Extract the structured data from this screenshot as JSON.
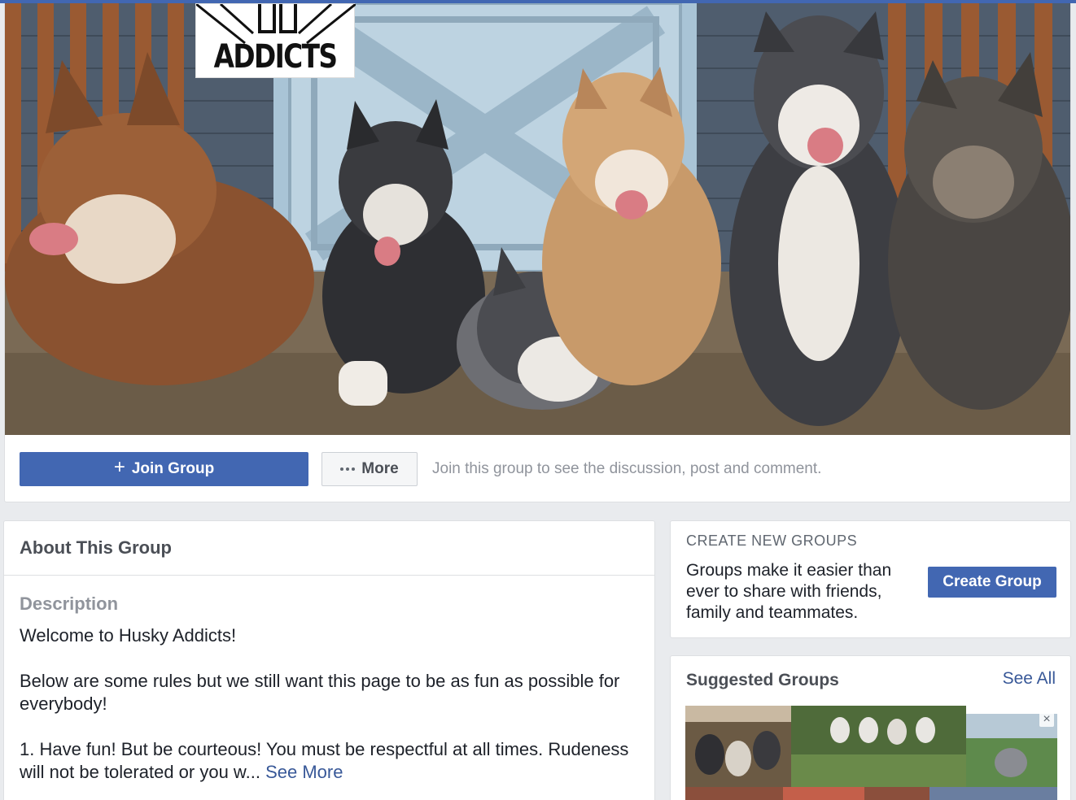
{
  "group": {
    "logo_text": "ADDICTS",
    "join_button": "Join Group",
    "more_button": "More",
    "join_hint": "Join this group to see the discussion, post and comment."
  },
  "about": {
    "title": "About This Group",
    "description_label": "Description",
    "paragraphs": [
      "Welcome to Husky Addicts!",
      "Below are some rules but we still want this page to be as fun as possible for everybody!",
      "1. Have fun! But be courteous! You must be respectful at all times. Rudeness will not be tolerated or you w..."
    ],
    "see_more": "See More"
  },
  "create_groups": {
    "header": "CREATE NEW GROUPS",
    "text": "Groups make it easier than ever to share with friends, family and teammates.",
    "button": "Create Group"
  },
  "suggested": {
    "title": "Suggested Groups",
    "see_all": "See All",
    "close_icon": "×"
  },
  "colors": {
    "brand": "#4267b2",
    "link": "#385898",
    "page_bg": "#e9ebee"
  },
  "icons": {
    "join": "plus-icon",
    "more": "dots-icon",
    "dismiss": "close-icon"
  }
}
